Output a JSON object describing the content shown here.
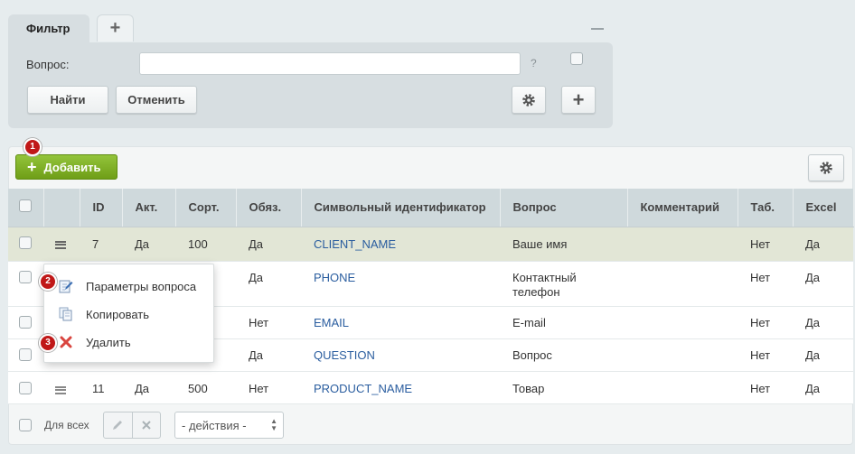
{
  "filter": {
    "tab_label": "Фильтр",
    "add_tab_label": "+",
    "question_label": "Вопрос:",
    "question_value": "",
    "help": "?",
    "find_button": "Найти",
    "cancel_button": "Отменить",
    "add_button": "+"
  },
  "toolbar": {
    "add_button": "Добавить",
    "add_plus": "+",
    "badge_add": "1"
  },
  "grid": {
    "columns": [
      "ID",
      "Акт.",
      "Сорт.",
      "Обяз.",
      "Символьный идентификатор",
      "Вопрос",
      "Комментарий",
      "Таб.",
      "Excel"
    ],
    "rows": [
      {
        "id": "7",
        "active": "Да",
        "sort": "100",
        "required": "Да",
        "code": "CLIENT_NAME",
        "question": "Ваше имя",
        "comment": "",
        "tab": "Нет",
        "excel": "Да"
      },
      {
        "id": "",
        "active": "",
        "sort": "",
        "required": "Да",
        "code": "PHONE",
        "question": "Контактный телефон",
        "comment": "",
        "tab": "Нет",
        "excel": "Да"
      },
      {
        "id": "",
        "active": "",
        "sort": "",
        "required": "Нет",
        "code": "EMAIL",
        "question": "E-mail",
        "comment": "",
        "tab": "Нет",
        "excel": "Да"
      },
      {
        "id": "",
        "active": "",
        "sort": "",
        "required": "Да",
        "code": "QUESTION",
        "question": "Вопрос",
        "comment": "",
        "tab": "Нет",
        "excel": "Да"
      },
      {
        "id": "11",
        "active": "Да",
        "sort": "500",
        "required": "Нет",
        "code": "PRODUCT_NAME",
        "question": "Товар",
        "comment": "",
        "tab": "Нет",
        "excel": "Да"
      }
    ]
  },
  "context_menu": {
    "items": [
      {
        "label": "Параметры вопроса",
        "icon": "edit-icon",
        "badge": "2"
      },
      {
        "label": "Копировать",
        "icon": "copy-icon",
        "badge": ""
      },
      {
        "label": "Удалить",
        "icon": "delete-icon",
        "badge": "3"
      }
    ]
  },
  "footer": {
    "for_all_label": "Для всех",
    "actions_select": "- действия -"
  },
  "colors": {
    "add_button": "#7cab25",
    "badge": "#c01818",
    "link": "#2a5d9f",
    "selected_row": "#e2e6d6"
  }
}
